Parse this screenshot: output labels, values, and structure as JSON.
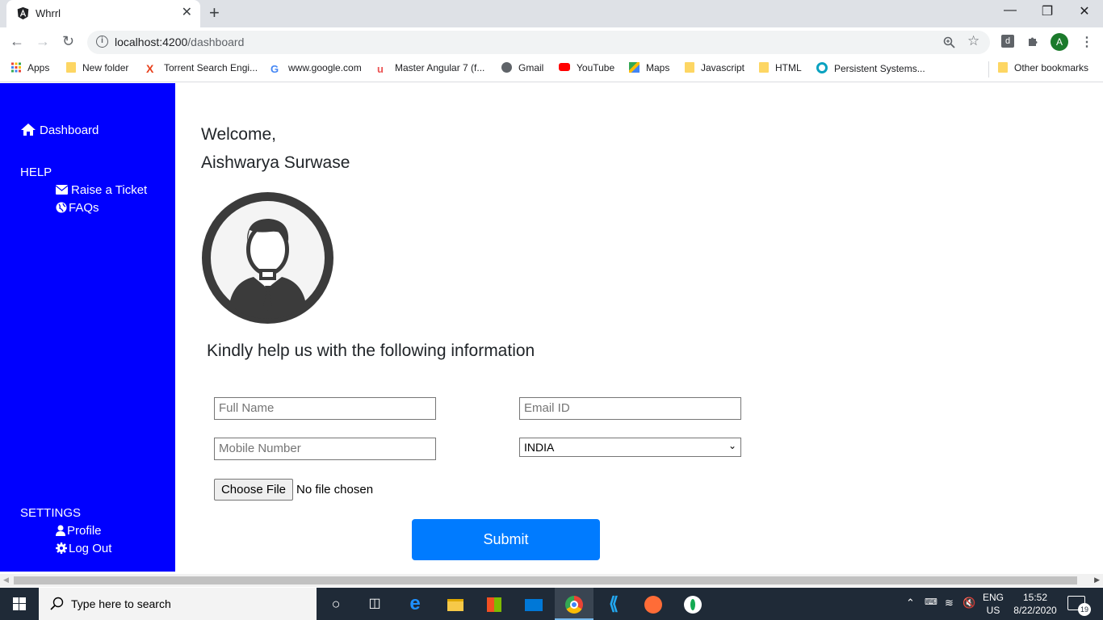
{
  "browser": {
    "tab_title": "Whrrl",
    "tab_close": "✕",
    "new_tab": "+",
    "url_host": "localhost:4200",
    "url_path": "/dashboard",
    "window": {
      "minimize": "—",
      "restore": "❐",
      "close": "✕"
    },
    "profile_initial": "A",
    "bookmarks": [
      {
        "label": "Apps",
        "icon": "apps-icon"
      },
      {
        "label": "New folder",
        "icon": "folder-icon"
      },
      {
        "label": "Torrent Search Engi...",
        "icon": "torrent-icon"
      },
      {
        "label": "www.google.com",
        "icon": "google-icon"
      },
      {
        "label": "Master Angular 7 (f...",
        "icon": "udemy-icon"
      },
      {
        "label": "Gmail",
        "icon": "globe-icon"
      },
      {
        "label": "YouTube",
        "icon": "youtube-icon"
      },
      {
        "label": "Maps",
        "icon": "maps-icon"
      },
      {
        "label": "Javascript",
        "icon": "folder-icon"
      },
      {
        "label": "HTML",
        "icon": "folder-icon"
      },
      {
        "label": "Persistent Systems...",
        "icon": "persistent-icon"
      },
      {
        "label": "Other bookmarks",
        "icon": "folder-icon"
      }
    ]
  },
  "sidebar": {
    "dashboard": "Dashboard",
    "help_heading": "HELP",
    "help_items": [
      {
        "label": "Raise a Ticket",
        "icon": "envelope-icon"
      },
      {
        "label": "FAQs",
        "icon": "globe-icon"
      }
    ],
    "settings_heading": "SETTINGS",
    "settings_items": [
      {
        "label": "Profile",
        "icon": "user-icon"
      },
      {
        "label": "Log Out",
        "icon": "gear-icon"
      }
    ]
  },
  "main": {
    "welcome": "Welcome,",
    "user_name": "Aishwarya Surwase",
    "form_heading": "Kindly help us with the following information",
    "full_name_placeholder": "Full Name",
    "email_placeholder": "Email ID",
    "mobile_placeholder": "Mobile Number",
    "country_selected": "INDIA",
    "choose_file": "Choose File",
    "no_file": "No file chosen",
    "submit": "Submit"
  },
  "taskbar": {
    "search_placeholder": "Type here to search",
    "lang_line1": "ENG",
    "lang_line2": "US",
    "time": "15:52",
    "date": "8/22/2020",
    "notifications": "19"
  },
  "colors": {
    "sidebar_bg": "#0000ff",
    "submit_bg": "#007bff",
    "taskbar_bg": "#1f2a37"
  }
}
